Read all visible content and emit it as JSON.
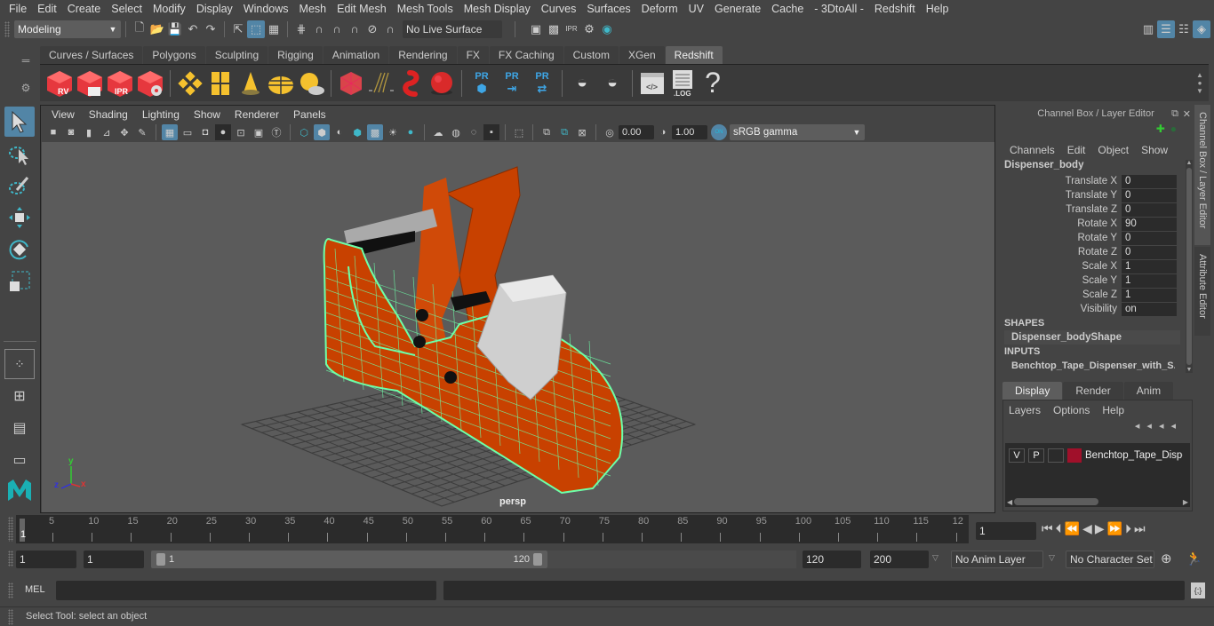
{
  "menubar": {
    "items": [
      "File",
      "Edit",
      "Create",
      "Select",
      "Modify",
      "Display",
      "Windows",
      "Mesh",
      "Edit Mesh",
      "Mesh Tools",
      "Mesh Display",
      "Curves",
      "Surfaces",
      "Deform",
      "UV",
      "Generate",
      "Cache",
      "- 3DtoAll -",
      "Redshift",
      "Help"
    ]
  },
  "statusline": {
    "workspace": "Modeling",
    "live_surface": "No Live Surface"
  },
  "shelf": {
    "tabs": [
      "Curves / Surfaces",
      "Polygons",
      "Sculpting",
      "Rigging",
      "Animation",
      "Rendering",
      "FX",
      "FX Caching",
      "Custom",
      "XGen",
      "Redshift"
    ],
    "active_tab": "Redshift",
    "icon_labels": {
      "rv": "RV",
      "ipr": "IPR",
      "pr": "PR",
      "log": ".LOG",
      "help": "?"
    }
  },
  "viewport": {
    "menu": [
      "View",
      "Shading",
      "Lighting",
      "Show",
      "Renderer",
      "Panels"
    ],
    "exposure": "0.00",
    "gamma": "1.00",
    "color_space": "sRGB gamma",
    "color_mgmt_badge": "ON",
    "camera_label": "persp",
    "axis": {
      "x": "x",
      "y": "y",
      "z": "z"
    }
  },
  "channel_box": {
    "title": "Channel Box / Layer Editor",
    "menu": [
      "Channels",
      "Edit",
      "Object",
      "Show"
    ],
    "object_name": "Dispenser_body",
    "channels": [
      {
        "label": "Translate X",
        "value": "0"
      },
      {
        "label": "Translate Y",
        "value": "0"
      },
      {
        "label": "Translate Z",
        "value": "0"
      },
      {
        "label": "Rotate X",
        "value": "90"
      },
      {
        "label": "Rotate Y",
        "value": "0"
      },
      {
        "label": "Rotate Z",
        "value": "0"
      },
      {
        "label": "Scale X",
        "value": "1"
      },
      {
        "label": "Scale Y",
        "value": "1"
      },
      {
        "label": "Scale Z",
        "value": "1"
      },
      {
        "label": "Visibility",
        "value": "on"
      }
    ],
    "shapes_header": "SHAPES",
    "shape_name": "Dispenser_bodyShape",
    "inputs_header": "INPUTS",
    "input_name": "Benchtop_Tape_Dispenser_with_S..."
  },
  "layer_editor": {
    "tabs": [
      "Display",
      "Render",
      "Anim"
    ],
    "active_tab": "Display",
    "menu": [
      "Layers",
      "Options",
      "Help"
    ],
    "layers": [
      {
        "v": "V",
        "p": "P",
        "name": "Benchtop_Tape_Dispenser",
        "color": "#a0102a"
      }
    ]
  },
  "side_tabs": [
    "Channel Box / Layer Editor",
    "Attribute Editor"
  ],
  "timeline": {
    "ticks": [
      "5",
      "10",
      "15",
      "20",
      "25",
      "30",
      "35",
      "40",
      "45",
      "50",
      "55",
      "60",
      "65",
      "70",
      "75",
      "80",
      "85",
      "90",
      "95",
      "100",
      "105",
      "110",
      "115",
      "12"
    ],
    "current_frame_marker": "1",
    "current_frame": "1"
  },
  "range": {
    "start": "1",
    "playback_start": "1",
    "slider_start": "1",
    "slider_end": "120",
    "playback_end": "120",
    "end": "200",
    "anim_layer": "No Anim Layer",
    "character_set": "No Character Set"
  },
  "command_line": {
    "label": "MEL"
  },
  "help_line": {
    "text": "Select Tool: select an object"
  },
  "colors": {
    "accent": "#5285a6",
    "selection_wire": "#6dffa8",
    "model_orange": "#c84100",
    "layer_color": "#a0102a"
  }
}
